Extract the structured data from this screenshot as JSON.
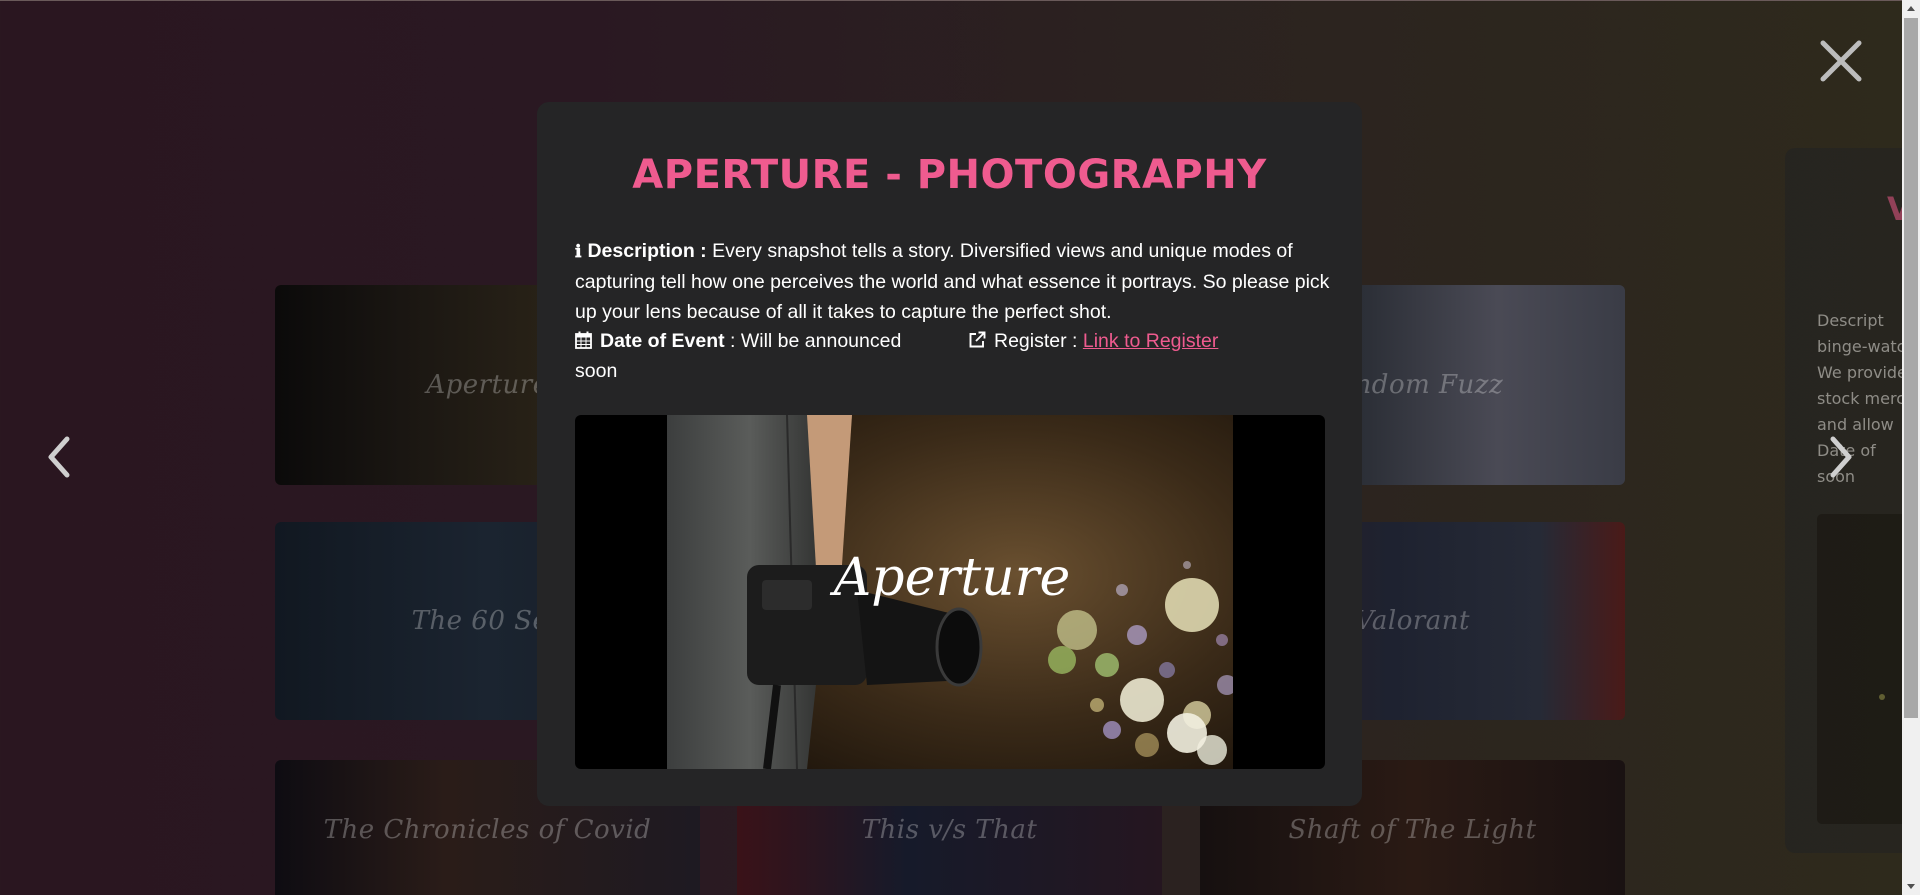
{
  "background_cards": [
    {
      "label": "Aperture"
    },
    {
      "label": "Fandom Fuzz"
    },
    {
      "label": "The 60 Sec"
    },
    {
      "label": "Valorant"
    },
    {
      "label": "The Chronicles of Covid"
    },
    {
      "label": "This v/s That"
    },
    {
      "label": "Shaft of The Light"
    }
  ],
  "side_modal": {
    "title_fragment": "V",
    "lines": [
      "Descript",
      "binge-watc",
      "We provide",
      "stock merc",
      "and allow",
      "Date of",
      "soon"
    ]
  },
  "modal": {
    "title": "APERTURE - PHOTOGRAPHY",
    "description_label": "Description :",
    "description_text": " Every snapshot tells a story. Diversified views and unique modes of capturing tell how one perceives the world and what essence it portrays. So please pick up your lens because of all it takes to capture the perfect shot.",
    "date_label": "Date of Event",
    "date_value": " : Will be announced soon",
    "register_label": "Register : ",
    "register_link": "Link to Register",
    "image_caption": "Aperture"
  },
  "icons": {
    "close": "close-icon",
    "prev": "chevron-left-icon",
    "next": "chevron-right-icon",
    "info": "info-icon",
    "calendar": "calendar-icon",
    "external": "external-link-icon"
  },
  "colors": {
    "accent": "#ef5b8f",
    "modal_bg": "#252526"
  }
}
